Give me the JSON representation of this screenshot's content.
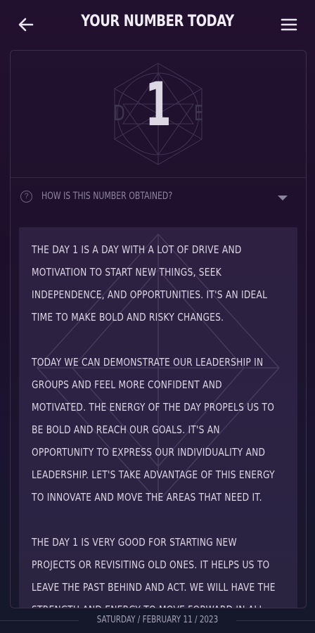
{
  "header": {
    "title": "YOUR NUMBER TODAY",
    "back_icon": "arrow-left-icon",
    "menu_icon": "hamburger-menu-icon"
  },
  "hero": {
    "number": "1",
    "letter_left": "D",
    "letter_right": "E"
  },
  "faq": {
    "label": "HOW IS THIS NUMBER OBTAINED?",
    "icon": "question-circle-icon",
    "chevron_icon": "chevron-down-icon"
  },
  "description": {
    "paragraphs": [
      "THE DAY 1 IS A DAY WITH A LOT OF DRIVE AND MOTIVATION TO START NEW THINGS, SEEK INDEPENDENCE, AND OPPORTUNITIES. IT'S AN IDEAL TIME TO MAKE BOLD AND RISKY CHANGES.",
      "TODAY WE CAN DEMONSTRATE OUR LEADERSHIP IN GROUPS AND FEEL MORE CONFIDENT AND MOTIVATED. THE ENERGY OF THE DAY PROPELS US TO BE BOLD AND REACH OUR GOALS. IT'S AN OPPORTUNITY TO EXPRESS OUR INDIVIDUALITY AND LEADERSHIP. LET'S TAKE ADVANTAGE OF THIS ENERGY TO INNOVATE AND MOVE THE AREAS THAT NEED IT.",
      "THE DAY 1 IS VERY GOOD FOR STARTING NEW PROJECTS OR REVISITING OLD ONES. IT HELPS US TO LEAVE THE PAST BEHIND AND ACT. WE WILL HAVE THE STRENGTH AND ENERGY TO MOVE FORWARD IN ALL"
    ]
  },
  "footer": {
    "date": "SATURDAY / FEBRUARY 11 / 2023"
  },
  "colors": {
    "background_top": "#22102f",
    "background_bottom": "#14182a",
    "text": "#ddd7e6",
    "muted": "#8d84a0"
  }
}
